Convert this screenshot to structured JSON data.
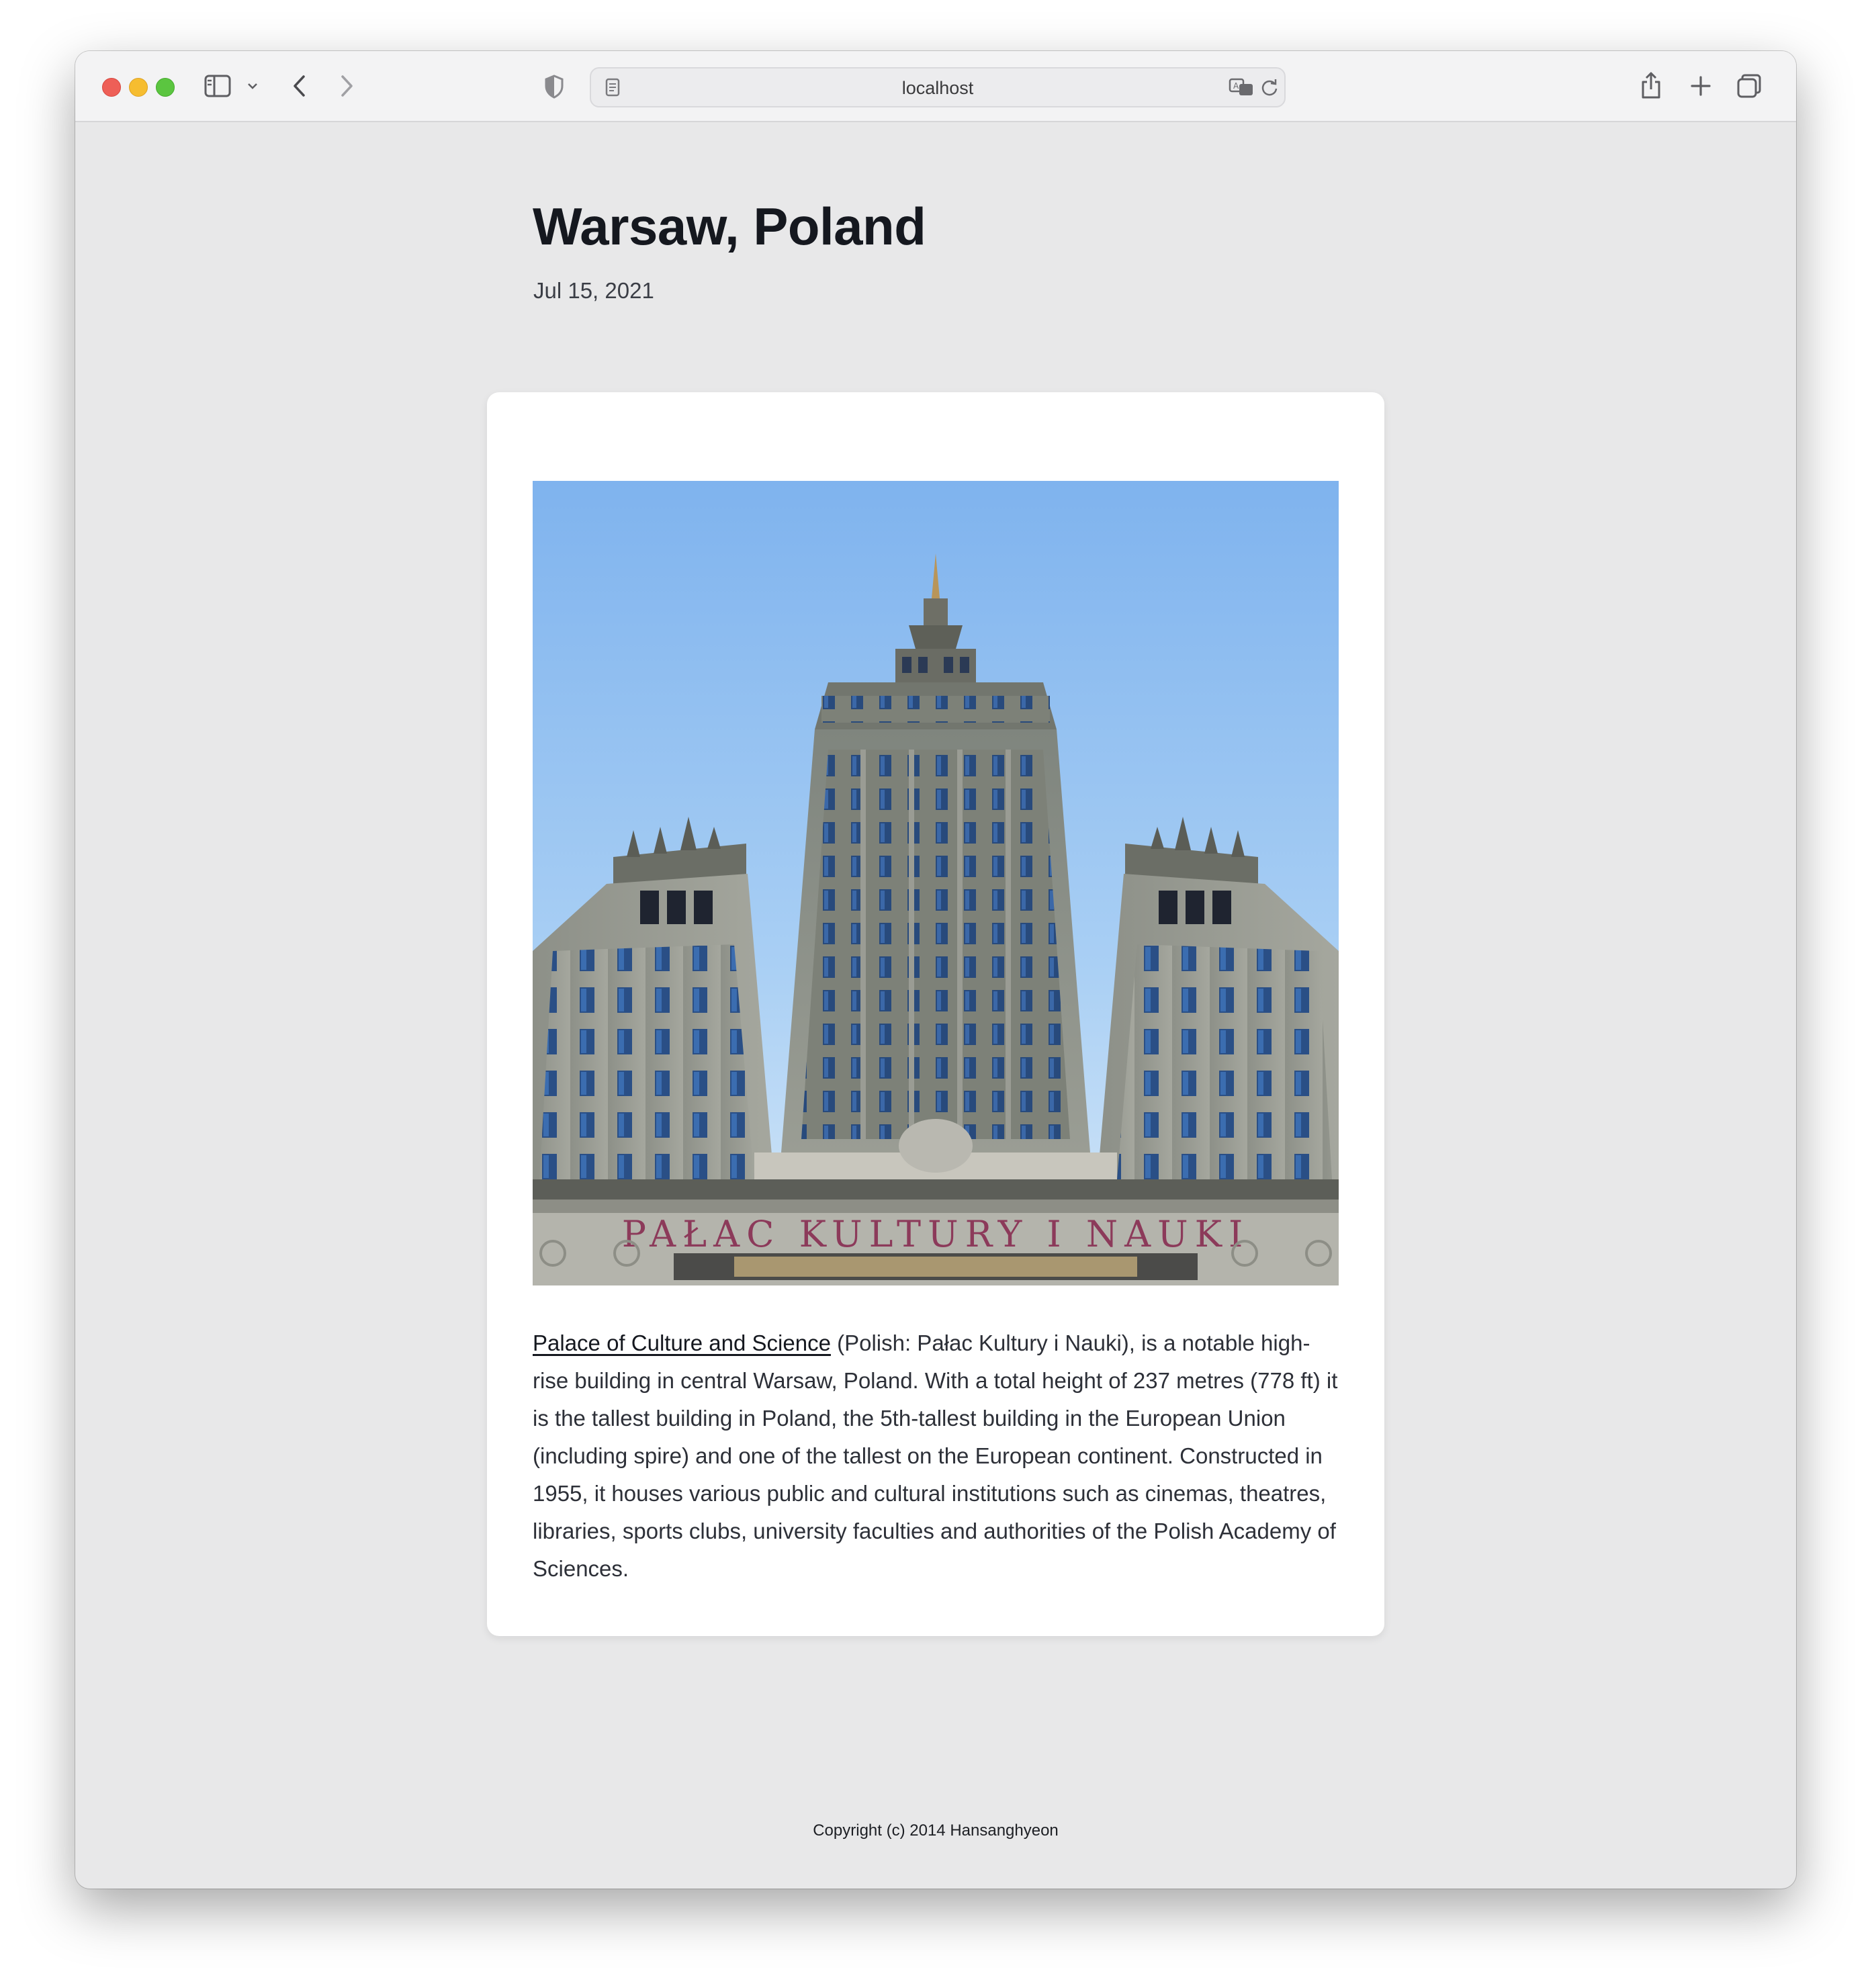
{
  "browser": {
    "url": "localhost"
  },
  "post": {
    "title": "Warsaw, Poland",
    "date": "Jul 15, 2021",
    "image_sign_text": "PAŁAC KULTURY I NAUKI",
    "description_link": "Palace of Culture and Science",
    "description_rest": " (Polish: Pałac Kultury i Nauki), is a notable high-rise building in central Warsaw, Poland. With a total height of 237 metres (778 ft) it is the tallest building in Poland, the 5th-tallest building in the European Union (including spire) and one of the tallest on the European continent. Constructed in 1955, it houses various public and cultural institutions such as cinemas, theatres, libraries, sports clubs, university faculties and authorities of the Polish Academy of Sciences."
  },
  "footer": {
    "copyright": "Copyright (c) 2014 Hansanghyeon"
  },
  "colors": {
    "page_bg": "#e8e8e9",
    "card_bg": "#ffffff",
    "title": "#15181f"
  }
}
